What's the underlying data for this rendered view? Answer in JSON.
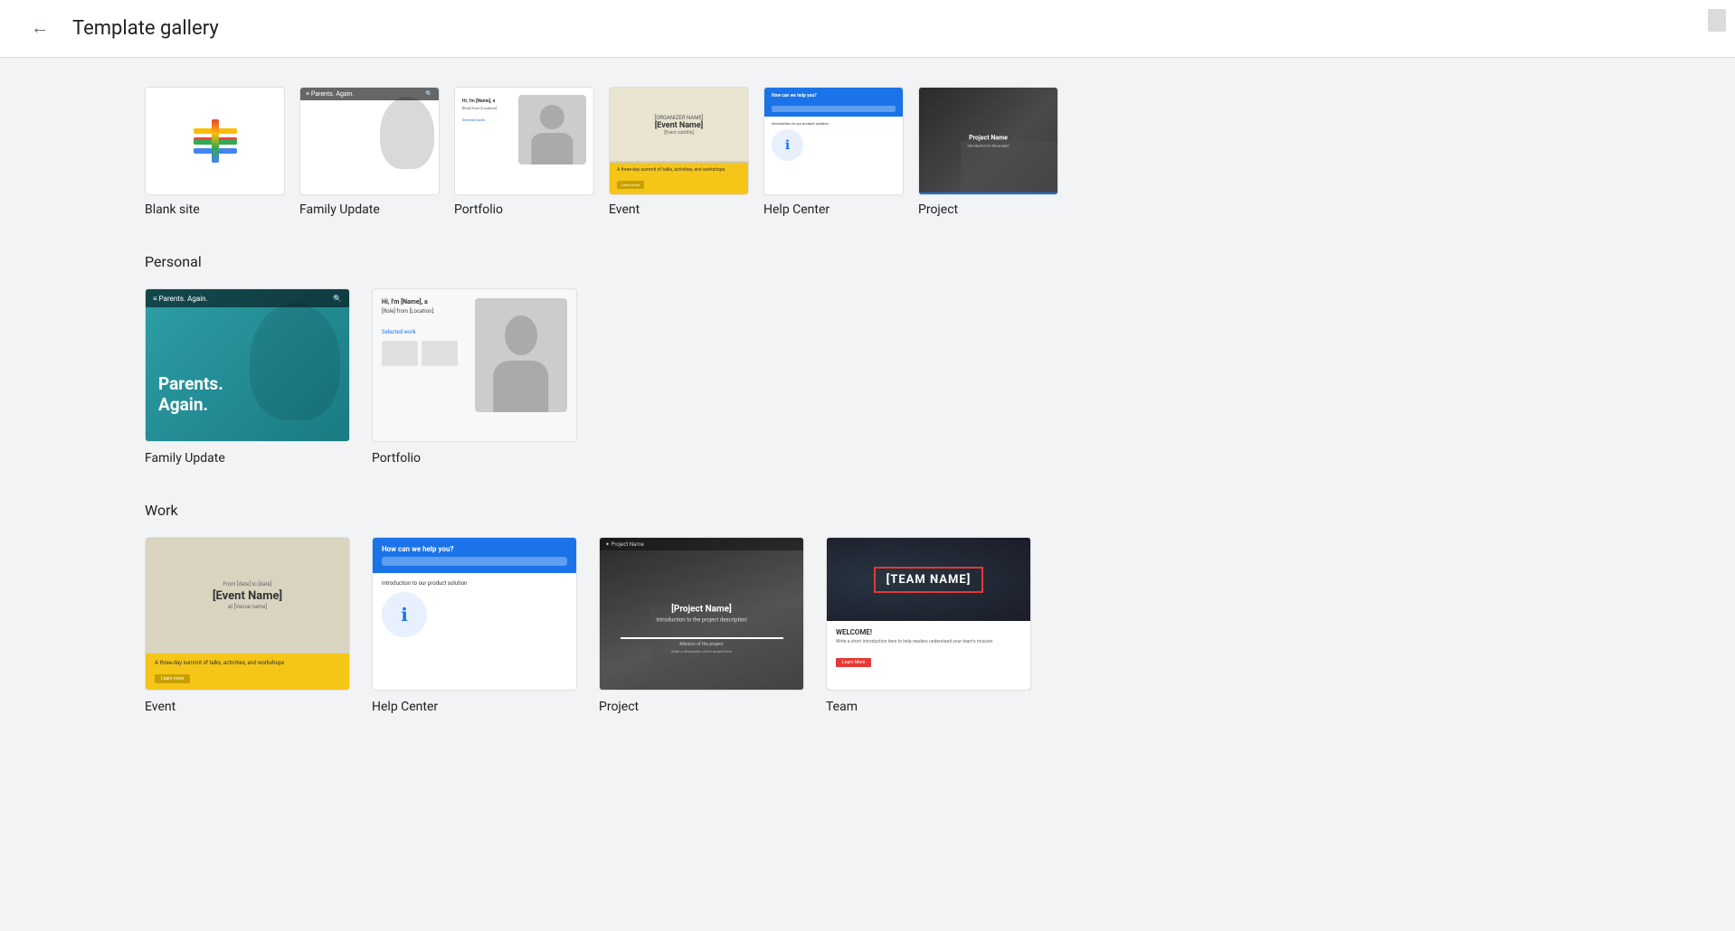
{
  "header": {
    "back_label": "←",
    "title": "Template gallery"
  },
  "featured": {
    "items": [
      {
        "id": "blank",
        "label": "Blank site"
      },
      {
        "id": "family-update",
        "label": "Family Update"
      },
      {
        "id": "portfolio",
        "label": "Portfolio"
      },
      {
        "id": "event",
        "label": "Event"
      },
      {
        "id": "help-center",
        "label": "Help Center"
      },
      {
        "id": "project",
        "label": "Project"
      }
    ]
  },
  "sections": [
    {
      "id": "personal",
      "title": "Personal",
      "items": [
        {
          "id": "family-update-lg",
          "label": "Family Update",
          "thumb": "family"
        },
        {
          "id": "portfolio-lg",
          "label": "Portfolio",
          "thumb": "portfolio"
        }
      ]
    },
    {
      "id": "work",
      "title": "Work",
      "items": [
        {
          "id": "event-lg",
          "label": "Event",
          "thumb": "event"
        },
        {
          "id": "help-center-lg",
          "label": "Help Center",
          "thumb": "help"
        },
        {
          "id": "project-lg",
          "label": "Project",
          "thumb": "project"
        },
        {
          "id": "team-lg",
          "label": "Team",
          "thumb": "team"
        }
      ]
    }
  ],
  "thumbnails": {
    "family": {
      "nav_text": "Parents. Again.",
      "hero_line1": "Parents.",
      "hero_line2": "Again."
    },
    "portfolio": {
      "header": "Hi, I'm [Name], a",
      "role": "[Role] from [Location].",
      "link": "Selected work"
    },
    "event": {
      "name": "[Event Name]",
      "desc": "A three-day summit of talks, activities, and workshops",
      "btn": "Learn more"
    },
    "help": {
      "hero": "How can we help you?",
      "intro": "Introduction to our product solution",
      "icon": "ℹ"
    },
    "project": {
      "title": "Project Name",
      "sub": "Introduction to the project"
    },
    "team": {
      "name": "[TEAM NAME]",
      "welcome": "WELCOME!",
      "desc": "Write a short introduction here to help readers understand your team's mission",
      "btn": "Learn More"
    }
  }
}
